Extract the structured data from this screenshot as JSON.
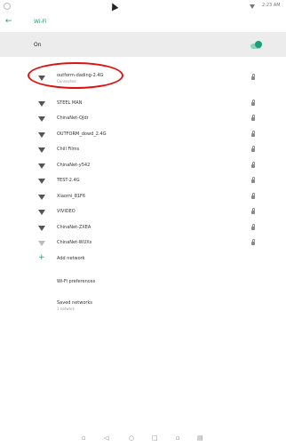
{
  "status_bar": {
    "time": "2:23 AM"
  },
  "header": {
    "title": "Wi-Fi"
  },
  "toggle": {
    "label": "On",
    "state": "on"
  },
  "networks": [
    {
      "name": "outform-dading-2.4G",
      "status": "Connected",
      "locked": true,
      "signal": "strong"
    },
    {
      "name": "STEEL MAN",
      "status": "",
      "locked": true,
      "signal": "strong"
    },
    {
      "name": "ChinaNet-QJdr",
      "status": "",
      "locked": true,
      "signal": "strong"
    },
    {
      "name": "OUTFORM_dowd_2.4G",
      "status": "",
      "locked": true,
      "signal": "strong"
    },
    {
      "name": "Chill Films",
      "status": "",
      "locked": true,
      "signal": "strong"
    },
    {
      "name": "ChinaNet-y542",
      "status": "",
      "locked": true,
      "signal": "strong"
    },
    {
      "name": "TEST-2.4G",
      "status": "",
      "locked": true,
      "signal": "strong"
    },
    {
      "name": "Xiaomi_81F6",
      "status": "",
      "locked": true,
      "signal": "strong"
    },
    {
      "name": "VIVIDEO",
      "status": "",
      "locked": true,
      "signal": "strong"
    },
    {
      "name": "ChinaNet-ZXEA",
      "status": "",
      "locked": true,
      "signal": "strong"
    },
    {
      "name": "ChinaNet-WUXs",
      "status": "",
      "locked": true,
      "signal": "weak"
    }
  ],
  "add_network": {
    "label": "Add network"
  },
  "preferences": {
    "title": "Wi-Fi preferences"
  },
  "saved": {
    "title": "Saved networks",
    "subtitle": "1 network"
  },
  "colors": {
    "accent": "#18a07a",
    "annotation": "#e01010",
    "toggle_bg": "#ececec"
  }
}
